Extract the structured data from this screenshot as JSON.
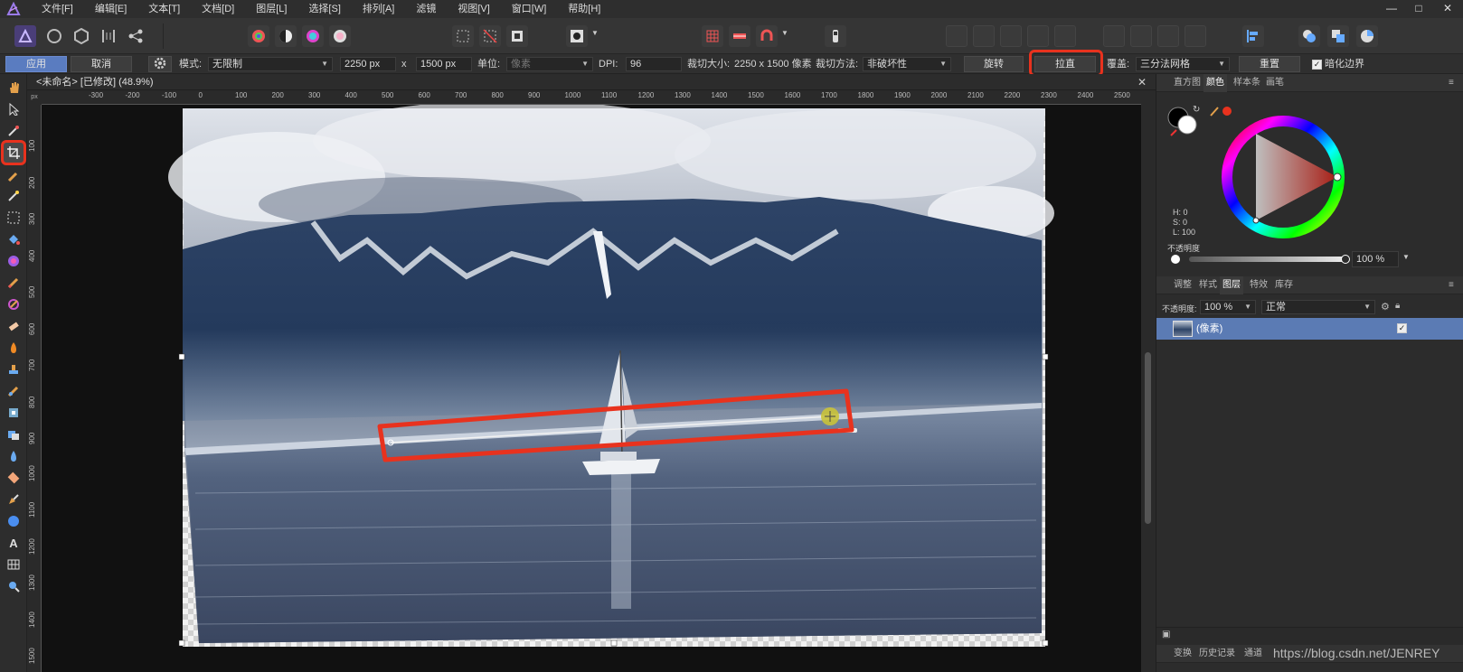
{
  "menubar": {
    "items": [
      "文件[F]",
      "编辑[E]",
      "文本[T]",
      "文档[D]",
      "图层[L]",
      "选择[S]",
      "排列[A]",
      "滤镜",
      "视图[V]",
      "窗口[W]",
      "帮助[H]"
    ],
    "minimize": "—",
    "maximize": "□",
    "close": "✕"
  },
  "context_toolbar": {
    "apply_label": "应用",
    "cancel_label": "取消",
    "mode_label": "模式:",
    "mode_value": "无限制",
    "width_value": "2250 px",
    "times_sign": "x",
    "height_value": "1500 px",
    "unit_label": "单位:",
    "unit_value": "像素",
    "dpi_label": "DPI:",
    "dpi_value": "96",
    "crop_size_label": "裁切大小:",
    "crop_size_value": "2250 x 1500 像素",
    "crop_method_label": "裁切方法:",
    "crop_method_value": "非破坏性",
    "rotate_label": "旋转",
    "straighten_label": "拉直",
    "overlay_label": "覆盖:",
    "overlay_value": "三分法网格",
    "reset_label": "重置",
    "darken_label": "暗化边界",
    "darken_checked": "✓"
  },
  "document": {
    "tab_title": "<未命名> [已修改] (48.9%)",
    "close": "✕"
  },
  "rulers": {
    "unit": "px",
    "h_labels": [
      "-300",
      "-200",
      "-100",
      "0",
      "100",
      "200",
      "300",
      "400",
      "500",
      "600",
      "700",
      "800",
      "900",
      "1000",
      "1100",
      "1200",
      "1300",
      "1400",
      "1500",
      "1600",
      "1700",
      "1800",
      "1900",
      "2000",
      "2100",
      "2200",
      "2300",
      "2400",
      "2500"
    ],
    "v_labels": [
      "100",
      "200",
      "300",
      "400",
      "500",
      "600",
      "700",
      "800",
      "900",
      "1000",
      "1100",
      "1200",
      "1300",
      "1400",
      "1500"
    ]
  },
  "color_panel": {
    "tabs": [
      "直方图",
      "颜色",
      "样本条",
      "画笔"
    ],
    "active_tab": "颜色",
    "h_text": "H: 0",
    "s_text": "S: 0",
    "l_text": "L: 100",
    "opacity_label": "不透明度",
    "opacity_value": "100 %",
    "accent": "#e8321e"
  },
  "layers_panel": {
    "tabs": [
      "调整",
      "样式",
      "图层",
      "特效",
      "库存"
    ],
    "active_tab": "图层",
    "opacity_label": "不透明度:",
    "opacity_value": "100 %",
    "blend_mode": "正常",
    "layer_name": "(像素)",
    "layer_checked": "✓"
  },
  "bottom_tabs": [
    "变换",
    "历史记录",
    "通道"
  ],
  "watermark": "https://blog.csdn.net/JENREY",
  "icons": [
    "affinity-photo-icon",
    "persona-pixel-icon",
    "persona-liquify-icon",
    "persona-develop-icon",
    "persona-tonemap-icon",
    "share-icon",
    "hand-icon",
    "move-icon",
    "color-picker-icon",
    "crop-icon",
    "selection-brush-icon",
    "wand-icon",
    "marquee-icon",
    "fill-icon",
    "gradient-icon",
    "paint-brush-icon",
    "mixer-brush-icon",
    "erase-icon",
    "dodge-icon",
    "clone-icon",
    "healing-icon",
    "blemish-icon",
    "red-eye-icon",
    "blur-icon",
    "sponge-icon",
    "pen-icon",
    "shape-icon",
    "text-icon",
    "mesh-warp-icon",
    "zoom-icon"
  ]
}
